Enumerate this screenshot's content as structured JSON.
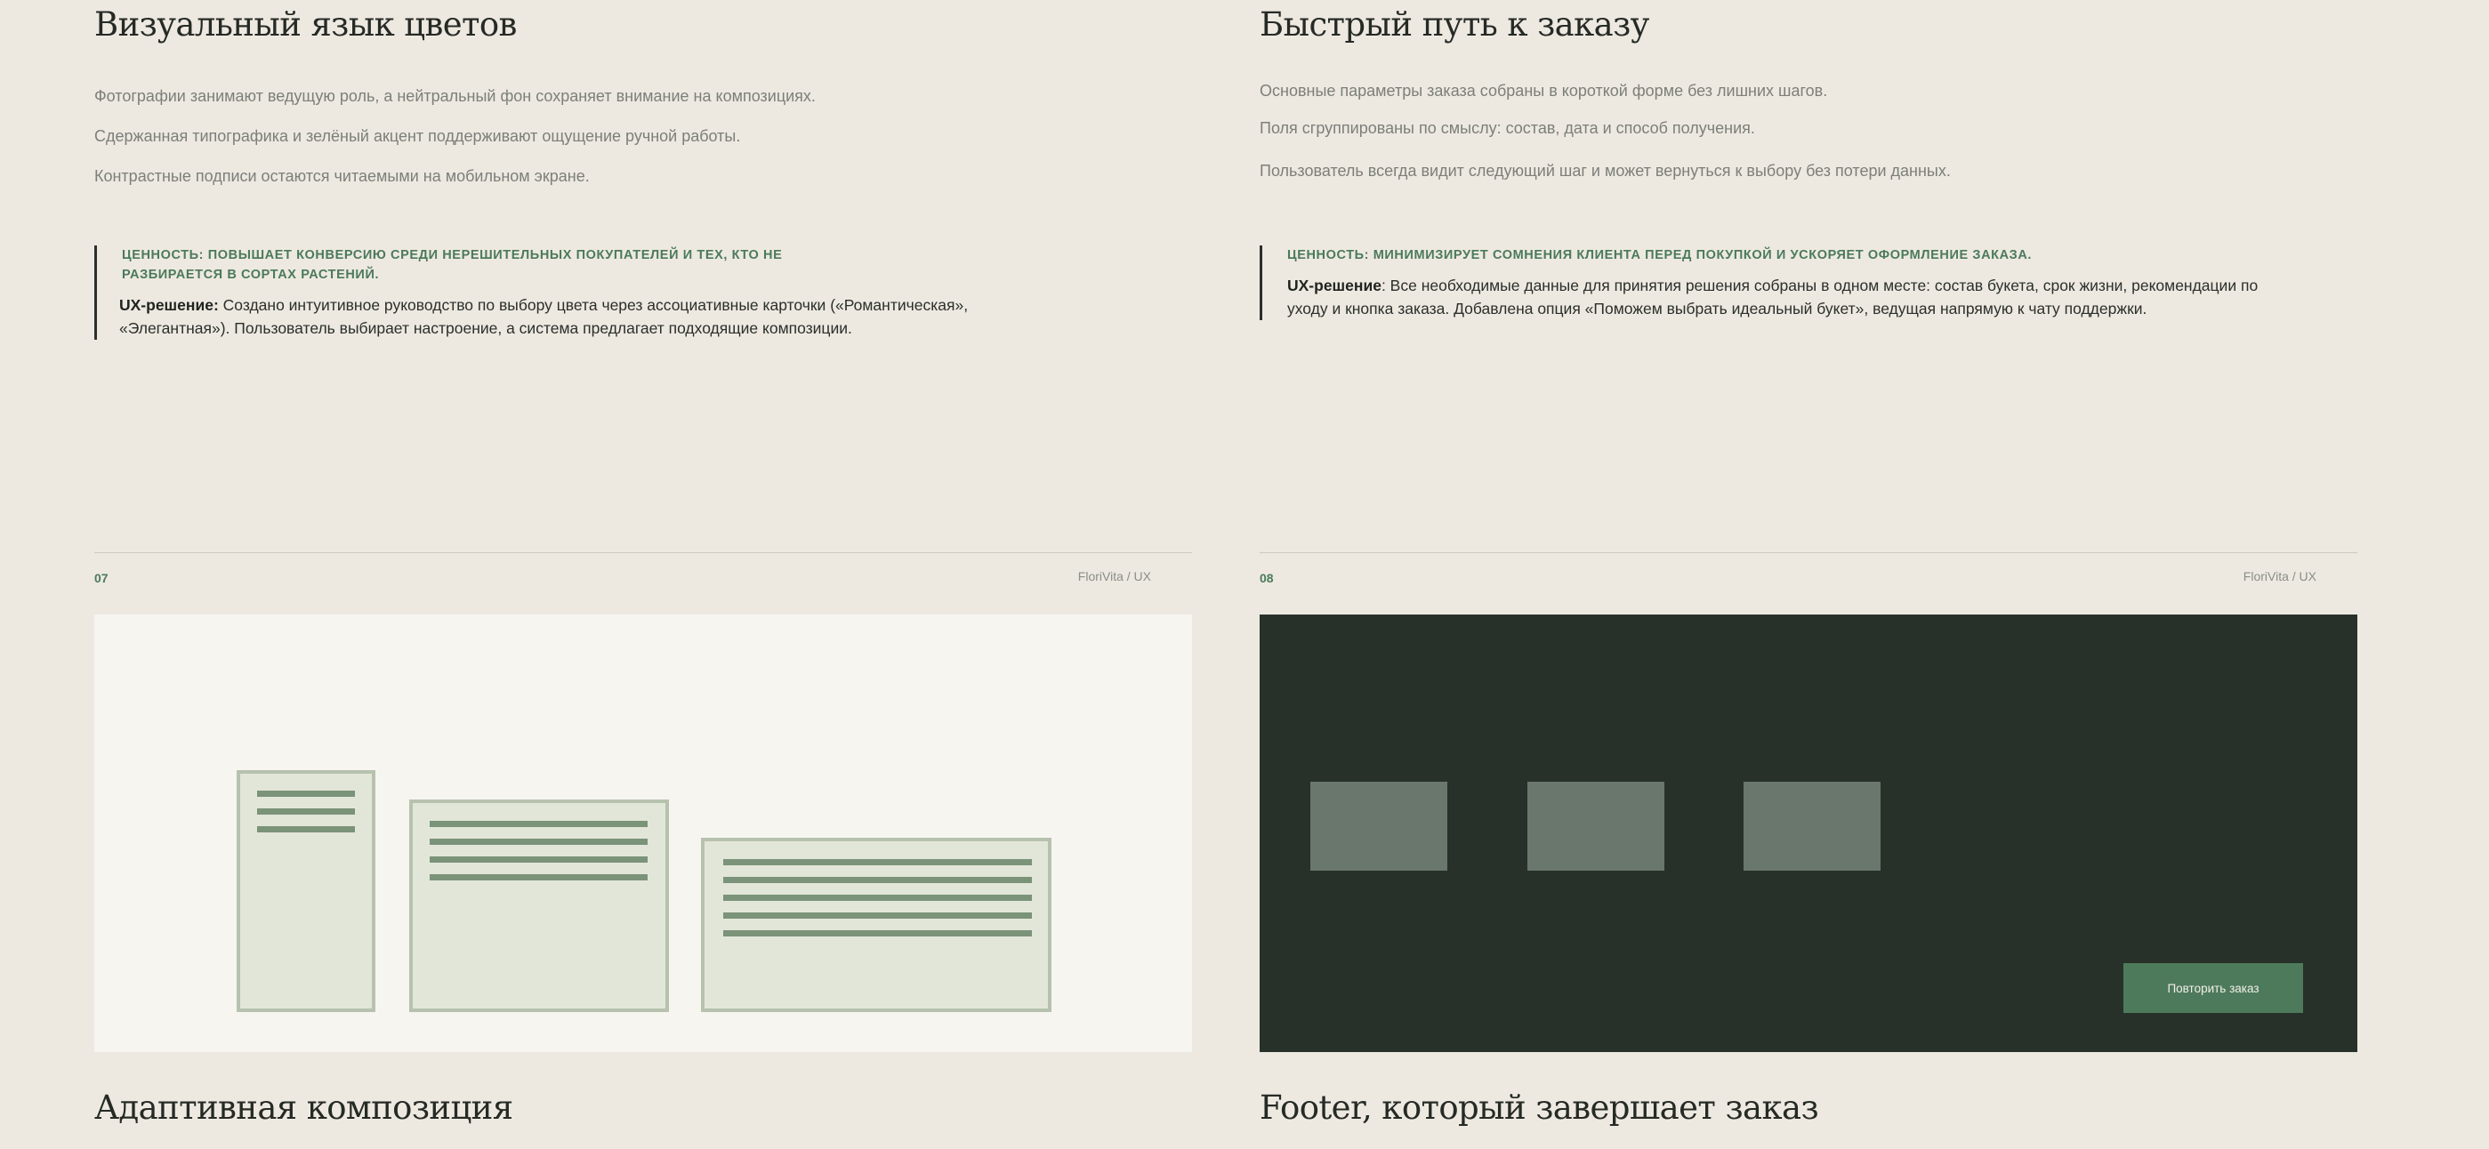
{
  "left": {
    "heading_top": "Визуальный язык цветов",
    "paragraphs": [
      "Фотографии занимают ведущую роль, а нейтральный фон сохраняет внимание на композициях.",
      "Сдержанная типографика и зелёный акцент поддерживают ощущение ручной работы.",
      "Контрастные подписи остаются читаемыми на мобильном экране."
    ],
    "value_line1": "Ценность: повышает конверсию среди нерешительных покупателей и тех, кто не",
    "value_line2": "разбирается в сортах растений.",
    "ux_label": "UX-решение:",
    "ux_line1": " Создано интуитивное руководство по выбору цвета через ассоциативные карточки («Романтическая»,",
    "ux_line2": "«Элегантная»). Пользователь выбирает настроение, а система предлагает подходящие композиции.",
    "slide_number": "07",
    "brand": "FloriVita / UX",
    "heading_bottom": "Адаптивная композиция"
  },
  "right": {
    "heading_top": "Быстрый путь к заказу",
    "paragraphs": [
      "Основные параметры заказа собраны в короткой форме без лишних шагов.",
      "Поля сгруппированы по смыслу: состав, дата и способ получения.",
      "Пользователь всегда видит следующий шаг и может вернуться к выбору без потери данных."
    ],
    "value_line1": "Ценность: минимизирует сомнения клиента перед покупкой и ускоряет оформление заказа.",
    "ux_label": "UX-решение",
    "ux_line1": ": Все необходимые данные для принятия решения собраны в одном месте: состав букета, срок жизни, рекомендации по",
    "ux_line2": "уходу и кнопка заказа. Добавлена опция «Поможем выбрать идеальный букет», ведущая напрямую к чату поддержки.",
    "slide_number": "08",
    "brand": "FloriVita / UX",
    "button_label": "Повторить заказ",
    "heading_bottom": "Footer, который завершает заказ"
  },
  "colors": {
    "background": "#ede9e1",
    "accent": "#4b7a5a",
    "dark_panel": "#273129",
    "card_fill": "#e2e6d8"
  }
}
